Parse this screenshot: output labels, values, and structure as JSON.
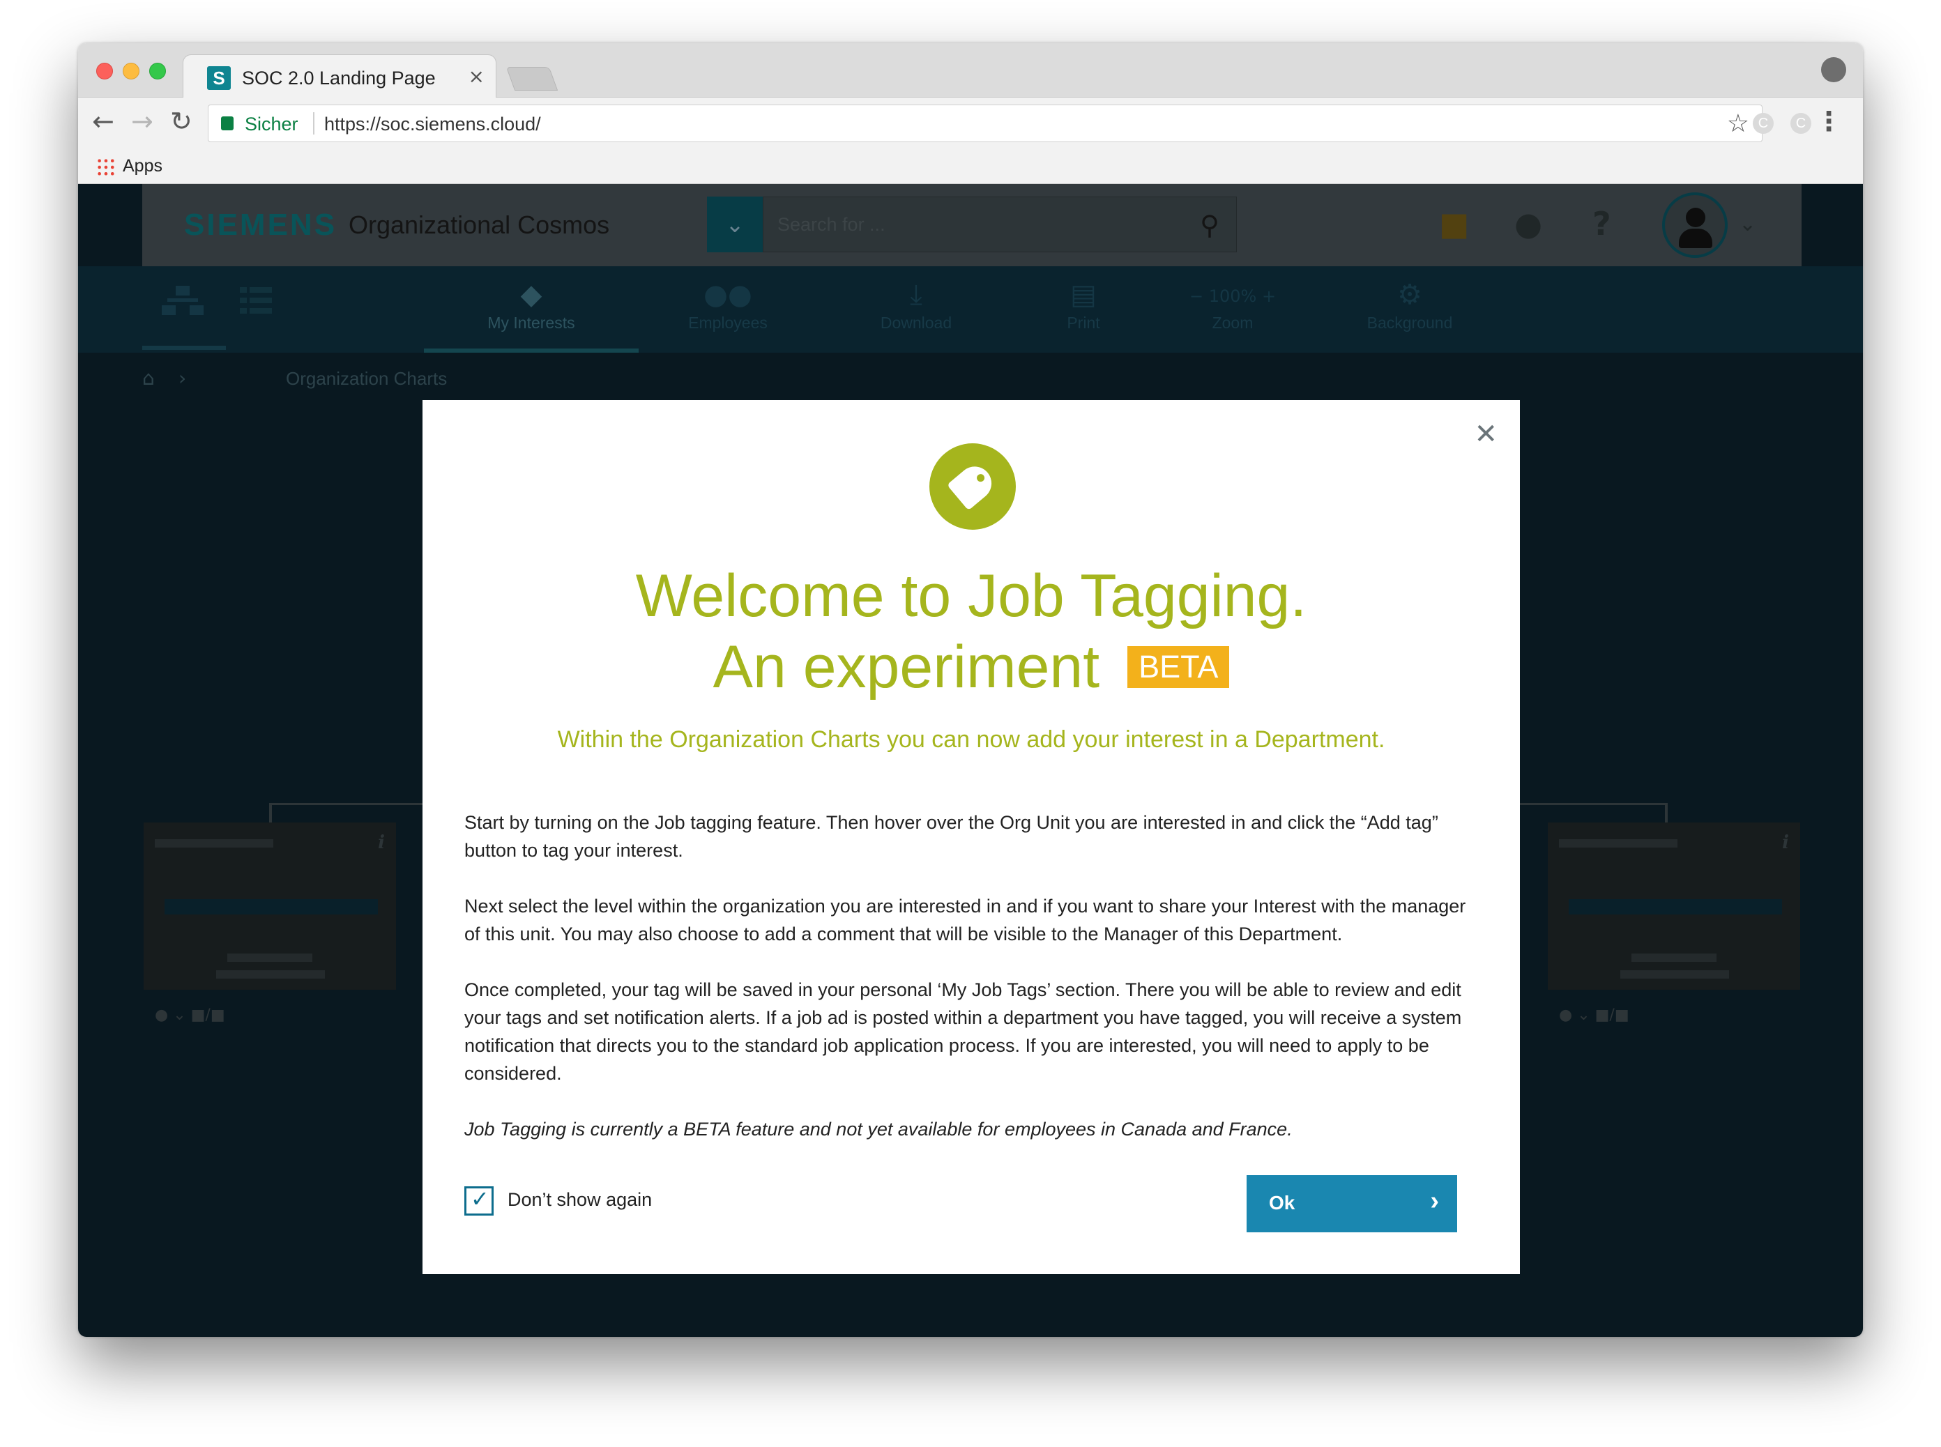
{
  "browser": {
    "tab_title": "SOC 2.0 Landing Page",
    "tab_favicon_letter": "S",
    "tab_close": "×",
    "secure_label": "Sicher",
    "url": "https://soc.siemens.cloud/",
    "bookmark_apps": "Apps",
    "ext_letter": "C"
  },
  "site": {
    "brand": "SIEMENS",
    "app_name": "Organizational Cosmos",
    "search_placeholder": "Search for ...",
    "subnav": [
      {
        "label": "My Interests",
        "icon": "tag-icon"
      },
      {
        "label": "Employees",
        "icon": "people-icon"
      },
      {
        "label": "Download",
        "icon": "download-icon"
      },
      {
        "label": "Print",
        "icon": "print-icon"
      },
      {
        "label": "100%",
        "icon": "zoom-icon",
        "caption": "Zoom"
      },
      {
        "label": "Background",
        "icon": "gear-icon"
      }
    ],
    "breadcrumb": "Organization Charts"
  },
  "modal": {
    "title_line1": "Welcome to Job Tagging.",
    "title_line2": "An experiment",
    "beta_badge": "BETA",
    "subtitle": "Within the Organization Charts you can now add your interest in a Department.",
    "paragraphs": [
      "Start by turning on the Job tagging feature. Then hover over the Org Unit you are interested in and click the “Add tag” button to tag your interest.",
      "Next select the level within the organization you are interested in and if you want to share your Interest with the manager of this unit. You may also choose to add a comment that will be visible to the Manager of this Department.",
      "Once completed, your tag will be saved in your personal ‘My Job Tags’ section. There you will be able to review and edit your tags and set notification alerts. If a job ad is posted within a department you have tagged, you will receive a system notification that directs you to the standard job application process. If you are interested, you will need to apply to be considered.",
      "Job Tagging is currently a BETA feature and not yet available for employees in Canada and France."
    ],
    "checkbox_label": "Don’t show again",
    "checkbox_checked": true,
    "ok_label": "Ok"
  },
  "colors": {
    "accent_green": "#a5b51d",
    "beta_yellow": "#f3b11b",
    "primary_blue": "#1a87b0"
  }
}
